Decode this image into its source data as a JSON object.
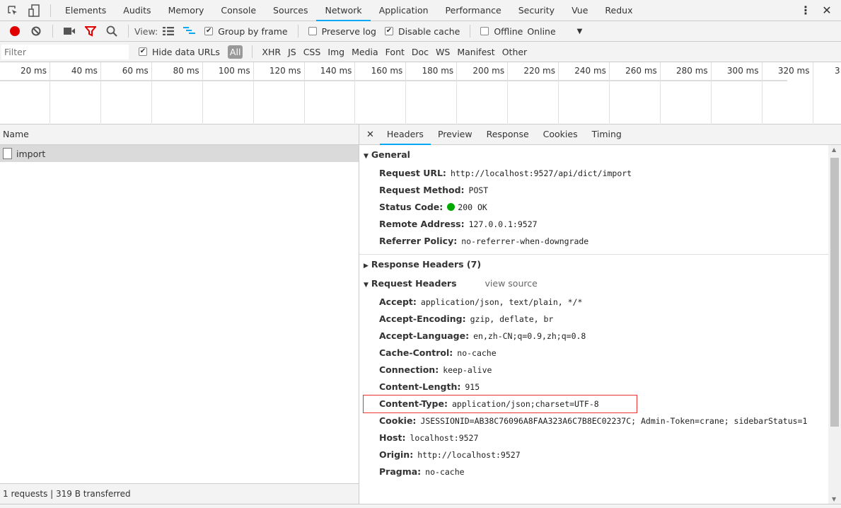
{
  "tabs": [
    "Elements",
    "Audits",
    "Memory",
    "Console",
    "Sources",
    "Network",
    "Application",
    "Performance",
    "Security",
    "Vue",
    "Redux"
  ],
  "active_tab": "Network",
  "toolbar": {
    "view_label": "View:",
    "group_by_frame": "Group by frame",
    "preserve_log": "Preserve log",
    "disable_cache": "Disable cache",
    "offline": "Offline",
    "throttle": "Online",
    "checked": {
      "group_by_frame": true,
      "preserve_log": false,
      "disable_cache": true,
      "offline": false
    }
  },
  "filter": {
    "placeholder": "Filter",
    "hide_data_urls": "Hide data URLs",
    "types": [
      "All",
      "XHR",
      "JS",
      "CSS",
      "Img",
      "Media",
      "Font",
      "Doc",
      "WS",
      "Manifest",
      "Other"
    ]
  },
  "timeline": {
    "ticks": [
      "20 ms",
      "40 ms",
      "60 ms",
      "80 ms",
      "100 ms",
      "120 ms",
      "140 ms",
      "160 ms",
      "180 ms",
      "200 ms",
      "220 ms",
      "240 ms",
      "260 ms",
      "280 ms",
      "300 ms",
      "320 ms",
      "3"
    ]
  },
  "requests": {
    "header": "Name",
    "items": [
      "import"
    ],
    "status": "1 requests | 319 B transferred"
  },
  "detail_tabs": [
    "Headers",
    "Preview",
    "Response",
    "Cookies",
    "Timing"
  ],
  "active_detail_tab": "Headers",
  "general": {
    "title": "General",
    "rows": [
      [
        "Request URL:",
        "http://localhost:9527/api/dict/import"
      ],
      [
        "Request Method:",
        "POST"
      ],
      [
        "Status Code:",
        "200 OK"
      ],
      [
        "Remote Address:",
        "127.0.0.1:9527"
      ],
      [
        "Referrer Policy:",
        "no-referrer-when-downgrade"
      ]
    ]
  },
  "response_headers": {
    "title": "Response Headers (7)"
  },
  "request_headers": {
    "title": "Request Headers",
    "view_source": "view source",
    "rows": [
      [
        "Accept:",
        "application/json, text/plain, */*"
      ],
      [
        "Accept-Encoding:",
        "gzip, deflate, br"
      ],
      [
        "Accept-Language:",
        "en,zh-CN;q=0.9,zh;q=0.8"
      ],
      [
        "Cache-Control:",
        "no-cache"
      ],
      [
        "Connection:",
        "keep-alive"
      ],
      [
        "Content-Length:",
        "915"
      ],
      [
        "Content-Type:",
        "application/json;charset=UTF-8"
      ],
      [
        "Cookie:",
        "JSESSIONID=AB38C76096A8FAA323A6C7B8EC02237C; Admin-Token=crane; sidebarStatus=1"
      ],
      [
        "Host:",
        "localhost:9527"
      ],
      [
        "Origin:",
        "http://localhost:9527"
      ],
      [
        "Pragma:",
        "no-cache"
      ]
    ]
  },
  "colors": {
    "accent": "#03a9f4",
    "record": "#e00000",
    "filter_active": "#e00000",
    "highlight_box": "#e33333",
    "status_ok": "#00aa00"
  }
}
